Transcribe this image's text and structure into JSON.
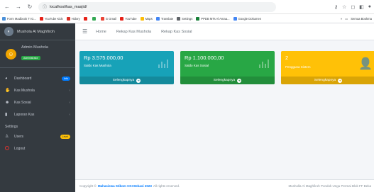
{
  "browser": {
    "url": "localhost/kas_masjid/",
    "bookmarks": [
      {
        "label": "Form Madbook TI G...",
        "color": "#4a90d9"
      },
      {
        "label": "YouTube Kids",
        "color": "#e62117"
      },
      {
        "label": "Hidory",
        "color": "#d93025"
      },
      {
        "label": "",
        "color": "#e62117"
      },
      {
        "label": "",
        "color": "#34a853"
      },
      {
        "label": "G Gmail",
        "color": "#ea4335"
      },
      {
        "label": "YouTube",
        "color": "#e62117"
      },
      {
        "label": "Maps",
        "color": "#fbbc05"
      },
      {
        "label": "Translate",
        "color": "#4285f4"
      },
      {
        "label": "Settings",
        "color": "#5f6368"
      },
      {
        "label": "PPDB MTs Al Amaa...",
        "color": "#188038"
      },
      {
        "label": "Google Dokumen",
        "color": "#4285f4"
      }
    ],
    "bookmarks_more": "»",
    "all_bookmarks": "Semua Bookma"
  },
  "sidebar": {
    "brand": "Mushola Al Maghfiroh",
    "user": {
      "name": "Admin Mushola",
      "role": "Administrator"
    },
    "items": [
      {
        "label": "Dashboard",
        "icon": "dashboard-icon",
        "badge": "Info"
      },
      {
        "label": "Kas Mushola",
        "icon": "hand-money-icon"
      },
      {
        "label": "Kas Sosial",
        "icon": "people-icon"
      },
      {
        "label": "Laporan Kas",
        "icon": "file-icon"
      }
    ],
    "settings_label": "Settings",
    "users": {
      "label": "Users",
      "badge": "Level"
    },
    "logout": "Logout"
  },
  "header": {
    "links": [
      "Home",
      "Rekap Kas Mushola",
      "Rekap Kas Sosial"
    ]
  },
  "cards": [
    {
      "value": "Rp 3.575.000,00",
      "label": "Saldo Kas Mushola",
      "footer": "Selengkapnya",
      "color": "#17a2b8",
      "footer_color": "#148a9c"
    },
    {
      "value": "Rp 1.100.000,00",
      "label": "Saldo Kas Sosial",
      "footer": "Selengkapnya",
      "color": "#28a745",
      "footer_color": "#228e3b"
    },
    {
      "value": "2",
      "label": "Pengguna Sistem",
      "footer": "Selengkapnya",
      "color": "#ffc107",
      "footer_color": "#d9a406"
    }
  ],
  "footer": {
    "prefix": "Copyright ©",
    "org": "Mahasiswa Stikom CKI Bekasi 2023",
    "suffix": "All rights reserved.",
    "right": "Musholla Al Maghfiroh Pondok Ungu Permai Blok FF Beka"
  }
}
